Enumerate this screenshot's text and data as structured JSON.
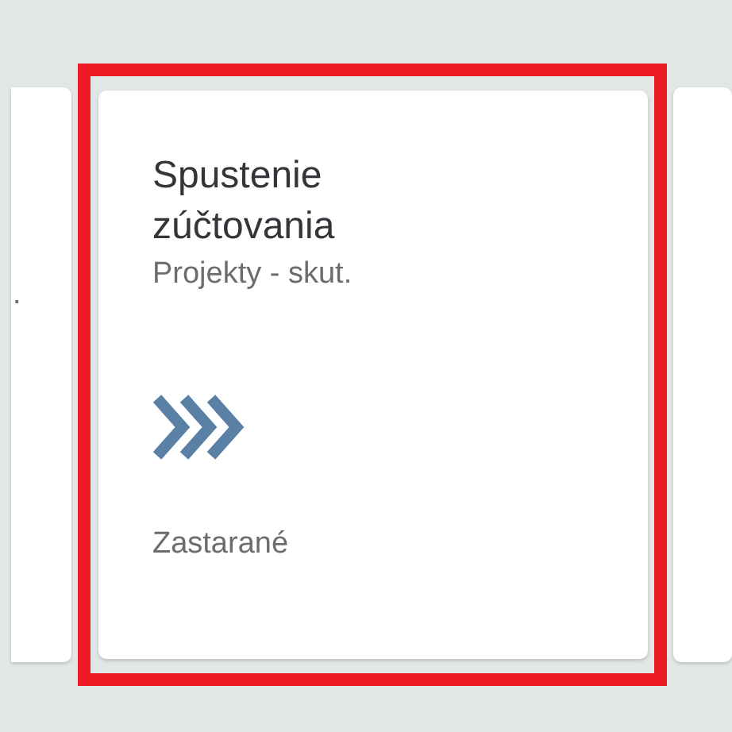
{
  "tiles": [
    {
      "kind": "partial",
      "title": "."
    },
    {
      "kind": "app",
      "highlighted": true,
      "title": "Spustenie zúčtovania",
      "subtitle": "Projekty - skut.",
      "footer": "Zastarané"
    },
    {
      "kind": "partial"
    }
  ]
}
